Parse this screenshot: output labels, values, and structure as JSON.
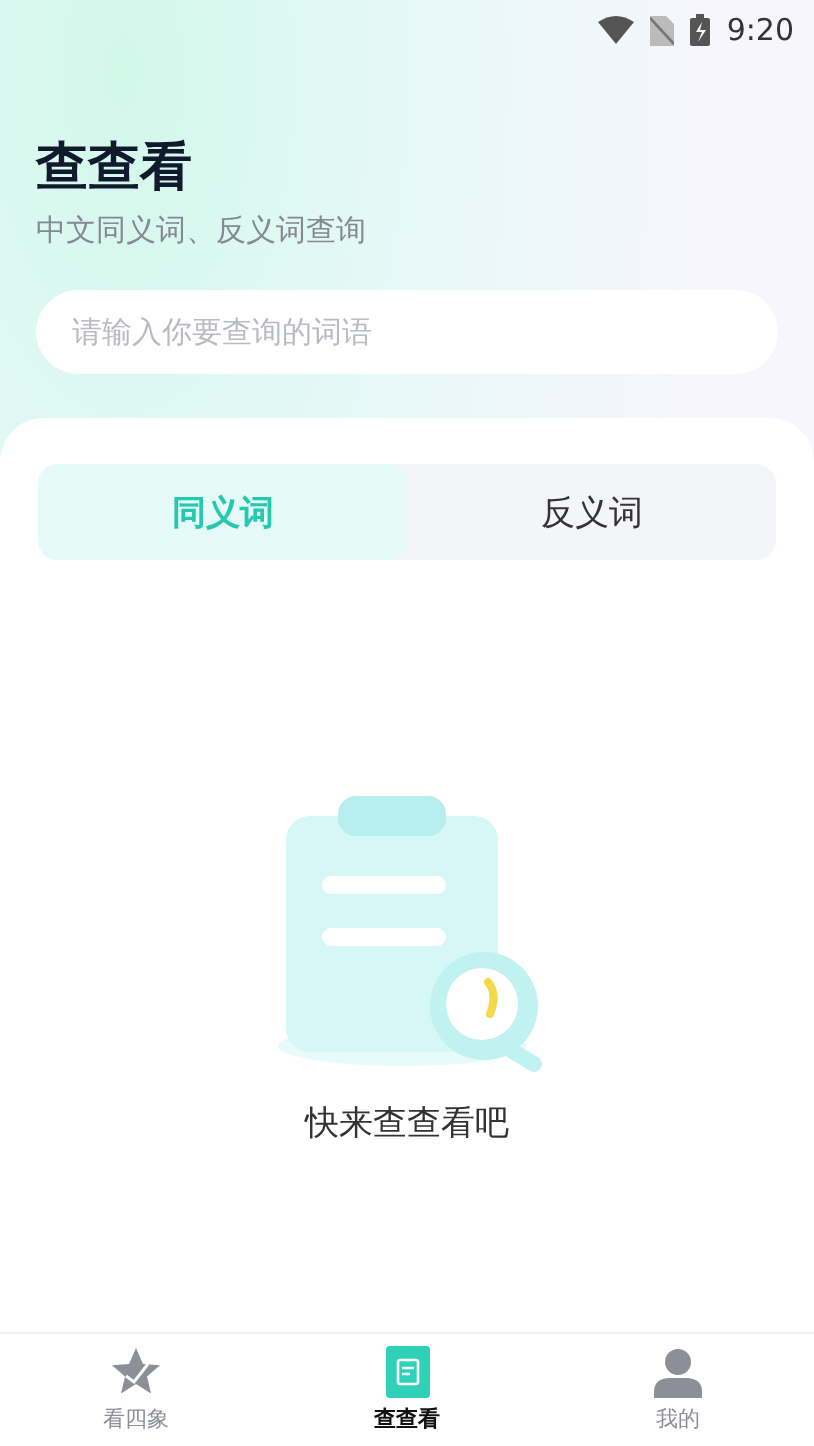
{
  "status_bar": {
    "time": "9:20"
  },
  "header": {
    "title": "查查看",
    "subtitle": "中文同义词、反义词查询"
  },
  "search": {
    "placeholder": "请输入你要查询的词语"
  },
  "tabs": [
    {
      "label": "同义词",
      "selected": true
    },
    {
      "label": "反义词",
      "selected": false
    }
  ],
  "empty_state": {
    "text": "快来查查看吧"
  },
  "bottom_nav": [
    {
      "label": "看四象",
      "kind": "star",
      "selected": false
    },
    {
      "label": "查查看",
      "kind": "book",
      "selected": true
    },
    {
      "label": "我的",
      "kind": "person",
      "selected": false
    }
  ]
}
